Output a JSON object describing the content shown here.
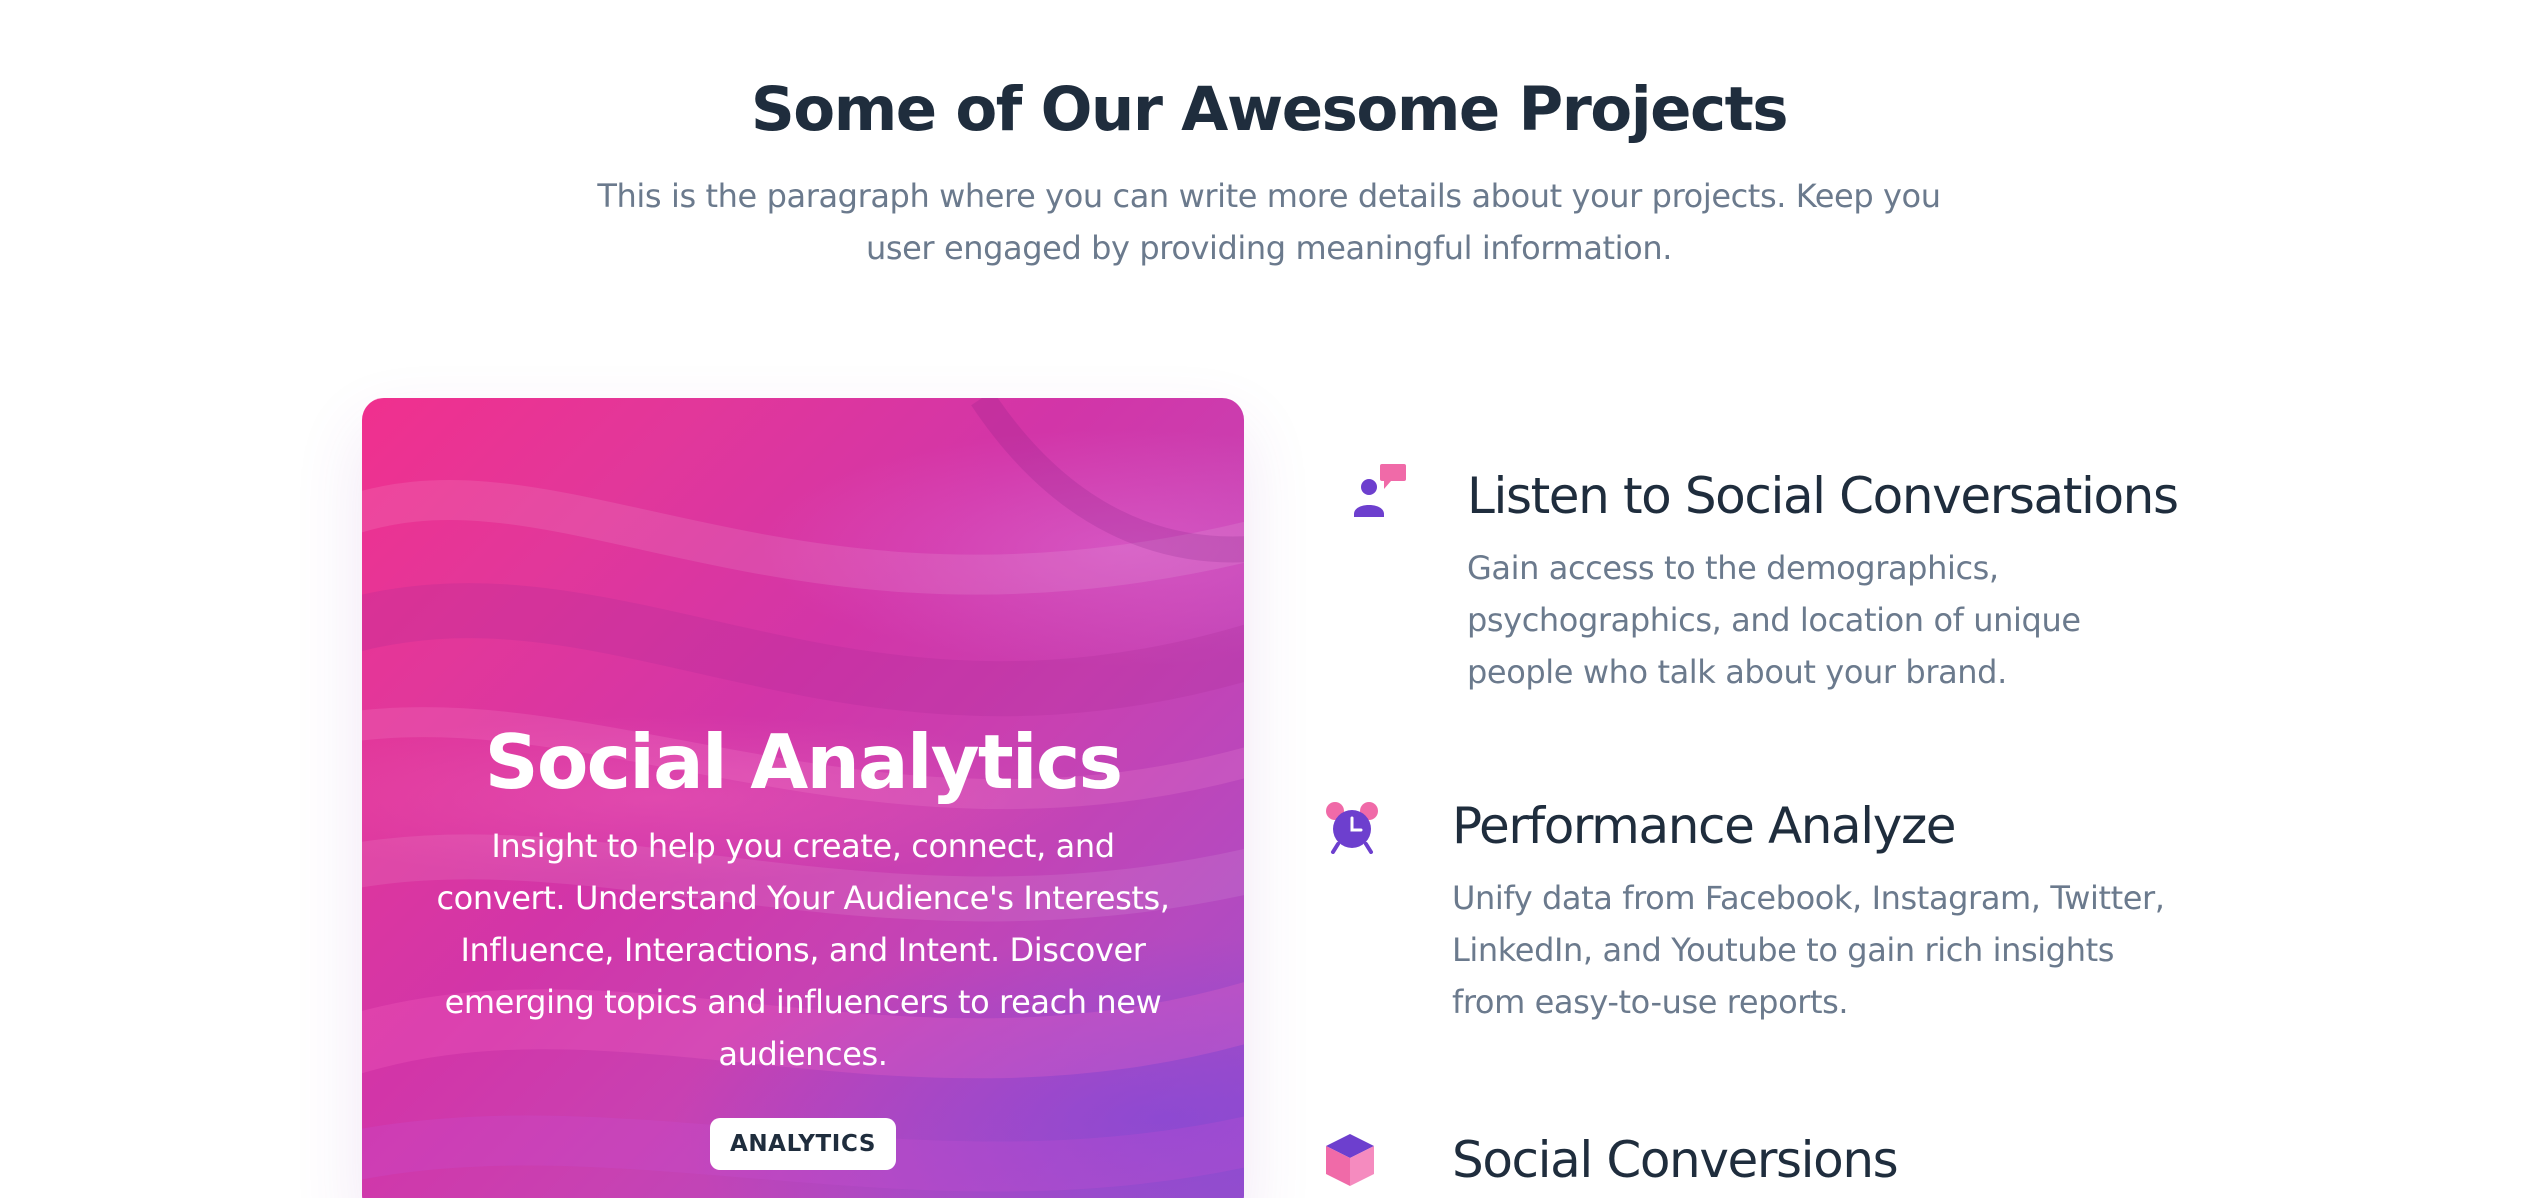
{
  "section": {
    "title": "Some of Our Awesome Projects",
    "subtitle": "This is the paragraph where you can write more details about your projects. Keep you user engaged by providing meaningful information."
  },
  "card": {
    "title": "Social Analytics",
    "text": "Insight to help you create, connect, and convert. Understand Your Audience's Interests, Influence, Interactions, and Intent. Discover emerging topics and influencers to reach new audiences.",
    "badge": "ANALYTICS",
    "colors": {
      "gradient_start": "#f0308e",
      "gradient_mid": "#d235a8",
      "gradient_end": "#9b50c9"
    }
  },
  "features": [
    {
      "icon": "user-chat-icon",
      "title": "Listen to Social Conversations",
      "text": "Gain access to the demographics, psychographics, and location of unique people who talk about your brand."
    },
    {
      "icon": "alarm-clock-icon",
      "title": "Performance Analyze",
      "text": "Unify data from Facebook, Instagram, Twitter, LinkedIn, and Youtube to gain rich insights from easy-to-use reports."
    },
    {
      "icon": "box-icon",
      "title": "Social Conversions",
      "text": ""
    }
  ],
  "colors": {
    "heading": "#1f2d3d",
    "body_text": "#6b7a8d",
    "icon_purple": "#6d3fce",
    "icon_pink": "#f06aa8"
  }
}
